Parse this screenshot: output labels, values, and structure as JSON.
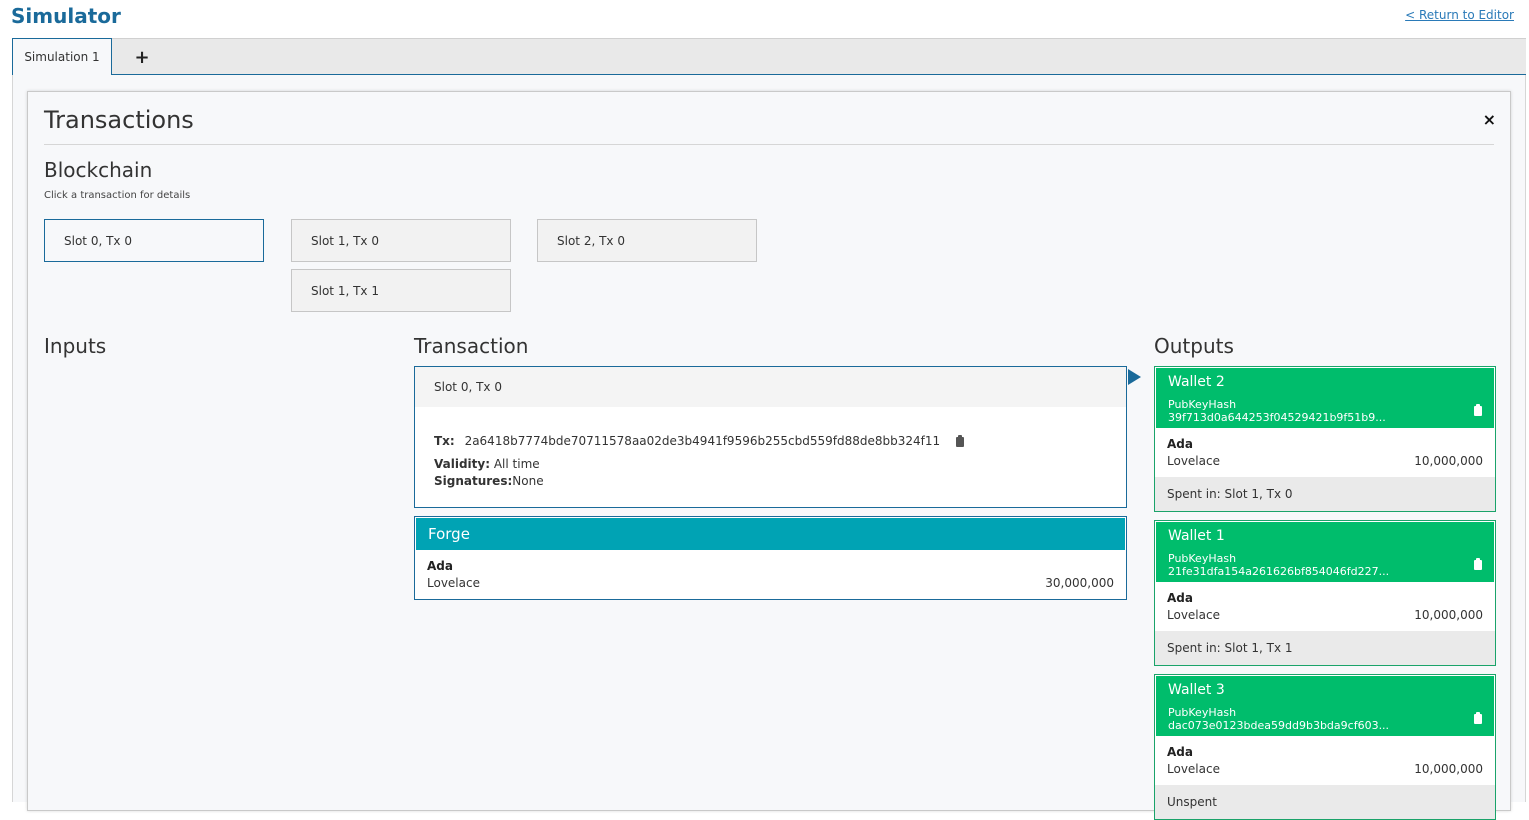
{
  "header": {
    "title": "Simulator",
    "return_link": "< Return to Editor"
  },
  "tabs": [
    {
      "label": "Simulation 1"
    }
  ],
  "tab_add_label": "+",
  "panel": {
    "title": "Transactions",
    "close": "×"
  },
  "blockchain": {
    "title": "Blockchain",
    "hint": "Click a transaction for details",
    "slots": [
      {
        "label": "Slot 0, Tx 0",
        "active": true
      },
      {
        "label": "Slot 1, Tx 0"
      },
      {
        "label": "Slot 1, Tx 1"
      },
      {
        "label": "Slot 2, Tx 0"
      }
    ]
  },
  "inputs": {
    "title": "Inputs"
  },
  "transaction": {
    "title": "Transaction",
    "header": "Slot 0, Tx 0",
    "tx_label": "Tx:",
    "tx_hash": "2a6418b7774bde70711578aa02de3b4941f9596b255cbd559fd88de8bb324f11",
    "validity_label": "Validity:",
    "validity_value": "All time",
    "signatures_label": "Signatures:",
    "signatures_value": "None"
  },
  "forge": {
    "title": "Forge",
    "currency": "Ada",
    "token": "Lovelace",
    "amount": "30,000,000"
  },
  "outputs": {
    "title": "Outputs",
    "wallets": [
      {
        "name": "Wallet 2",
        "key": "PubKeyHash 39f713d0a644253f04529421b9f51b9...",
        "currency": "Ada",
        "token": "Lovelace",
        "amount": "10,000,000",
        "status": "Spent in: Slot 1, Tx 0"
      },
      {
        "name": "Wallet 1",
        "key": "PubKeyHash 21fe31dfa154a261626bf854046fd227...",
        "currency": "Ada",
        "token": "Lovelace",
        "amount": "10,000,000",
        "status": "Spent in: Slot 1, Tx 1"
      },
      {
        "name": "Wallet 3",
        "key": "PubKeyHash dac073e0123bdea59dd9b3bda9cf603...",
        "currency": "Ada",
        "token": "Lovelace",
        "amount": "10,000,000",
        "status": "Unspent"
      }
    ]
  },
  "colors": {
    "accent": "#1a6a9a",
    "forge": "#00a3b4",
    "wallet": "#00bd6c"
  },
  "icons": {
    "copy": "clipboard-icon",
    "close": "close-icon",
    "arrow": "play-arrow-icon"
  }
}
